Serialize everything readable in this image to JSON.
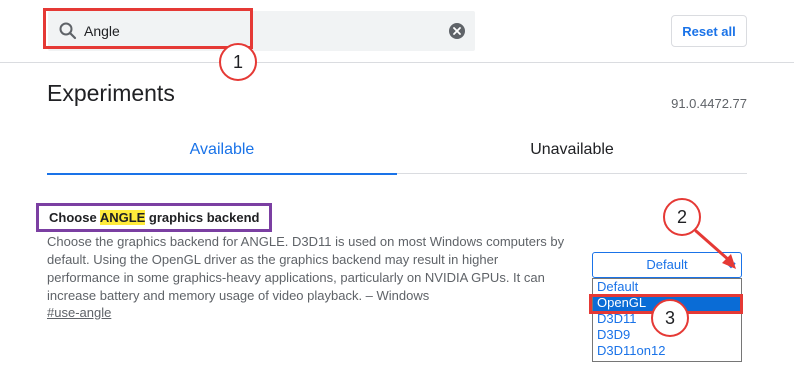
{
  "header": {
    "search": {
      "icon": "search-icon",
      "value": "Angle",
      "clear_icon": "clear-icon"
    },
    "reset_label": "Reset all"
  },
  "page": {
    "title": "Experiments",
    "version": "91.0.4472.77"
  },
  "tabs": [
    {
      "label": "Available",
      "active": true
    },
    {
      "label": "Unavailable",
      "active": false
    }
  ],
  "flag": {
    "title_prefix": "Choose ",
    "title_highlight": "ANGLE",
    "title_suffix": " graphics backend",
    "description": "Choose the graphics backend for ANGLE. D3D11 is used on most Windows computers by default. Using the OpenGL driver as the graphics backend may result in higher performance in some graphics-heavy applications, particularly on NVIDIA GPUs. It can increase battery and memory usage of video playback. – Windows",
    "link": "#use-angle",
    "select": {
      "value": "Default",
      "chevron_icon": "chevron-down-icon",
      "options": [
        "Default",
        "OpenGL",
        "D3D11",
        "D3D9",
        "D3D11on12"
      ],
      "highlighted_option": "OpenGL"
    }
  },
  "annotations": {
    "steps": [
      "1",
      "2",
      "3"
    ]
  },
  "colors": {
    "accent": "#1a73e8",
    "annotation_red": "#e53935",
    "annotation_purple": "#7b3fa2",
    "highlight_yellow": "#ffeb3b",
    "selected_option": "#0a6cd6"
  }
}
